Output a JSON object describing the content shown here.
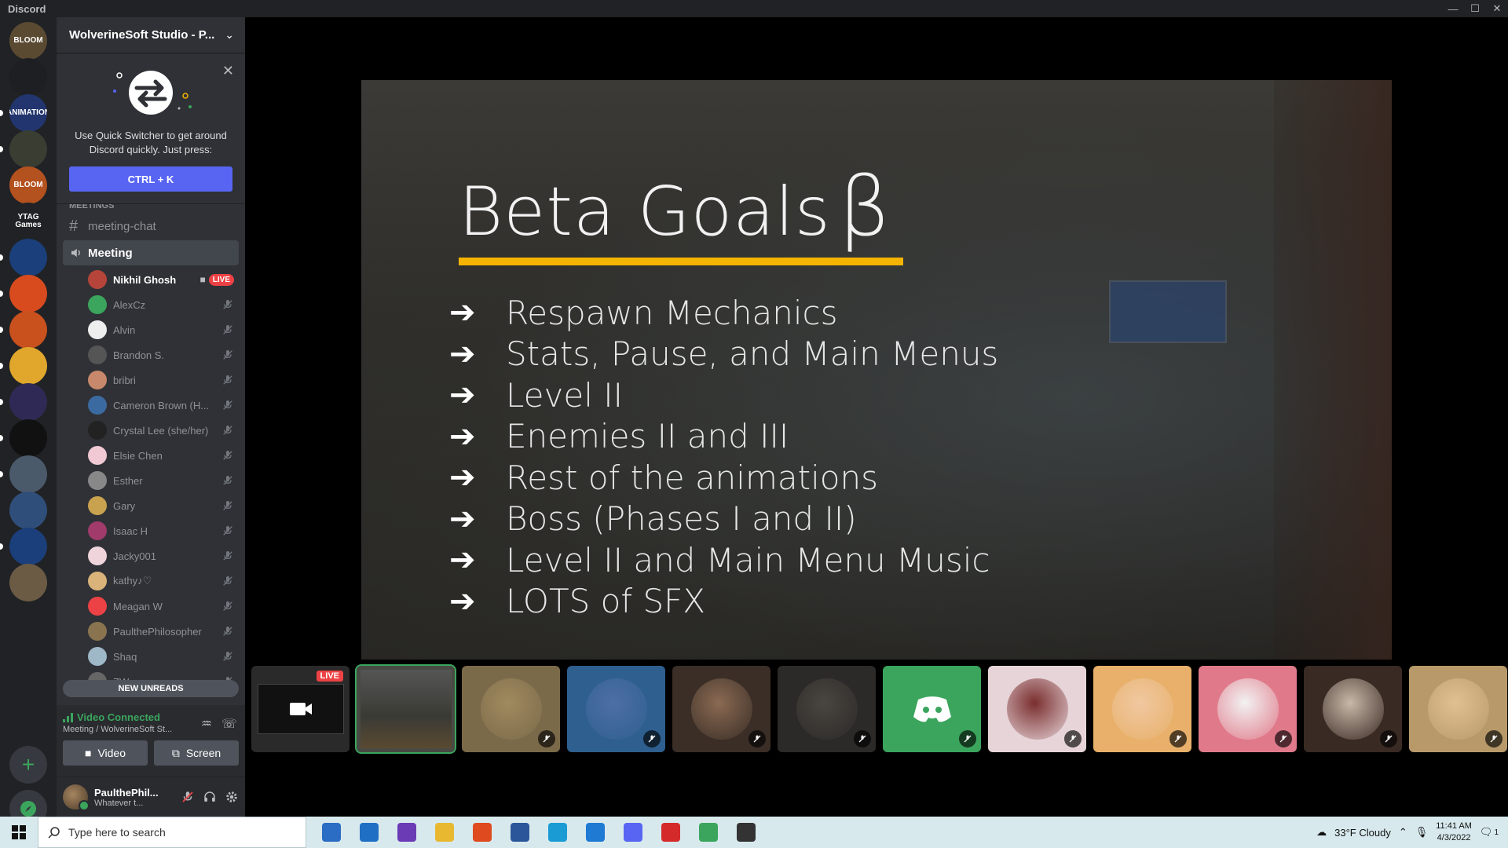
{
  "window": {
    "title": "Discord",
    "minimize": "—",
    "maximize": "☐",
    "close": "✕"
  },
  "servers": [
    {
      "label": "BLOOM",
      "color": "#5b4a32"
    },
    {
      "label": "",
      "color": "#1d1f22"
    },
    {
      "label": "ANIMATION",
      "color": "#22356e"
    },
    {
      "label": "",
      "color": "#3a3d32"
    },
    {
      "label": "BLOOM",
      "color": "#b3511f"
    },
    {
      "label": "YTAG Games",
      "color": "#202225"
    },
    {
      "label": "",
      "color": "#1b3f7a"
    },
    {
      "label": "",
      "color": "#d74b1f"
    },
    {
      "label": "",
      "color": "#c8511e"
    },
    {
      "label": "",
      "color": "#e0a72c"
    },
    {
      "label": "",
      "color": "#2f2a55"
    },
    {
      "label": "",
      "color": "#111"
    },
    {
      "label": "",
      "color": "#4b5a6b"
    },
    {
      "label": "",
      "color": "#2f4f7a"
    },
    {
      "label": "",
      "color": "#1b3f7a"
    },
    {
      "label": "",
      "color": "#6b5a44"
    }
  ],
  "guild": {
    "name": "WolverineSoft Studio - P..."
  },
  "quick_switcher": {
    "text": "Use Quick Switcher to get around Discord quickly. Just press:",
    "button": "CTRL + K"
  },
  "channels": {
    "category": "MEETINGS",
    "text_channel": "meeting-chat",
    "voice_channel": "Meeting",
    "live_label": "LIVE",
    "members": [
      {
        "name": "Nikhil Ghosh",
        "color": "#b5453a"
      },
      {
        "name": "AlexCz",
        "color": "#3ba55d"
      },
      {
        "name": "Alvin",
        "color": "#eee"
      },
      {
        "name": "Brandon S.",
        "color": "#555"
      },
      {
        "name": "bribri",
        "color": "#c8886b"
      },
      {
        "name": "Cameron Brown (H...",
        "color": "#3b6aa0"
      },
      {
        "name": "Crystal Lee (she/her)",
        "color": "#222"
      },
      {
        "name": "Elsie Chen",
        "color": "#f0c9d4"
      },
      {
        "name": "Esther",
        "color": "#888"
      },
      {
        "name": "Gary",
        "color": "#c8a24e"
      },
      {
        "name": "Isaac H",
        "color": "#a03b6b"
      },
      {
        "name": "Jacky001",
        "color": "#f0d4dc"
      },
      {
        "name": "kathy♪♡",
        "color": "#d9b37a"
      },
      {
        "name": "Meagan W",
        "color": "#ed4245"
      },
      {
        "name": "PaulthePhilosopher",
        "color": "#8a7450"
      },
      {
        "name": "Shaq",
        "color": "#9fb8c8"
      },
      {
        "name": "ZW",
        "color": "#666"
      }
    ]
  },
  "new_unreads": "NEW UNREADS",
  "voice": {
    "status": "Video Connected",
    "location": "Meeting / WolverineSoft St...",
    "video_label": "Video",
    "screen_label": "Screen"
  },
  "user": {
    "name": "PaulthePhil...",
    "status": "Whatever t..."
  },
  "slide": {
    "title": "Beta Goals",
    "beta_symbol": "β",
    "arrow": "➔",
    "goals": [
      "Respawn Mechanics",
      "Stats, Pause, and Main Menus",
      "Level II",
      "Enemies II and III",
      "Rest of the animations",
      "Boss (Phases I and II)",
      "Level II and Main Menu Music",
      "LOTS of SFX"
    ],
    "accent": "#f4b400"
  },
  "tiles": [
    {
      "kind": "live",
      "color": "#2a2a2a",
      "live": "LIVE"
    },
    {
      "kind": "selected",
      "color": "#4a4a44"
    },
    {
      "kind": "avatar",
      "color": "#7b6a4a",
      "face": "#a08a5e"
    },
    {
      "kind": "avatar",
      "color": "#2e5f8f",
      "face": "#4e6fa7"
    },
    {
      "kind": "avatar",
      "color": "#3a2e27",
      "face": "#8a6a52"
    },
    {
      "kind": "avatar",
      "color": "#2b2a28",
      "face": "#4a4540"
    },
    {
      "kind": "discord",
      "color": "#3ba55d",
      "face": "#3ba55d"
    },
    {
      "kind": "avatar",
      "color": "#e6d4d8",
      "face": "#7a2e2e"
    },
    {
      "kind": "avatar",
      "color": "#e8b06a",
      "face": "#f0c8a0"
    },
    {
      "kind": "avatar",
      "color": "#e07a8a",
      "face": "#f2f2f2"
    },
    {
      "kind": "avatar",
      "color": "#3a2a24",
      "face": "#c8b8a8"
    },
    {
      "kind": "avatar",
      "color": "#b89a6a",
      "face": "#e0c090"
    }
  ],
  "taskbar": {
    "search_placeholder": "Type here to search",
    "weather": "33°F  Cloudy",
    "time": "11:41 AM",
    "date": "4/3/2022",
    "notifications": "1",
    "apps": [
      {
        "name": "store",
        "color": "#2b6cc4"
      },
      {
        "name": "mail",
        "color": "#1f6fc4"
      },
      {
        "name": "podcast",
        "color": "#6b3bb5"
      },
      {
        "name": "explorer",
        "color": "#e8b830"
      },
      {
        "name": "office",
        "color": "#e04a1f"
      },
      {
        "name": "word",
        "color": "#2b579a"
      },
      {
        "name": "edge",
        "color": "#1a9bd4"
      },
      {
        "name": "vscode",
        "color": "#1f7ad4"
      },
      {
        "name": "discord",
        "color": "#5865f2"
      },
      {
        "name": "media",
        "color": "#d42a2a"
      },
      {
        "name": "chrome",
        "color": "#3ba55d"
      },
      {
        "name": "obs",
        "color": "#333"
      }
    ]
  }
}
